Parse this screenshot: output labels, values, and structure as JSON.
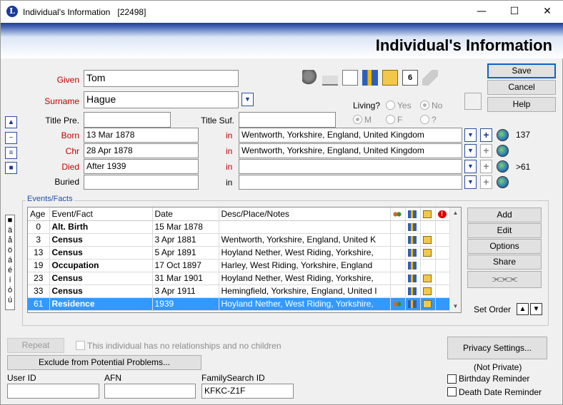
{
  "window": {
    "title": "Individual's Information",
    "id": "[22498]",
    "minimize": "—",
    "maximize": "☐",
    "close": "✕"
  },
  "banner": {
    "title": "Individual's Information"
  },
  "buttons": {
    "save": "Save",
    "cancel": "Cancel",
    "help": "Help",
    "add": "Add",
    "edit": "Edit",
    "options": "Options",
    "share": "Share",
    "repeat": "Repeat",
    "exclude": "Exclude from Potential Problems...",
    "privacy": "Privacy Settings..."
  },
  "fields": {
    "given_label": "Given",
    "given": "Tom",
    "surname_label": "Surname",
    "surname": "Hague",
    "title_pre_label": "Title Pre.",
    "title_pre": "",
    "title_suf_label": "Title Suf.",
    "title_suf": "",
    "living_label": "Living?",
    "yes": "Yes",
    "no": "No",
    "sex_m": "M",
    "sex_f": "F",
    "sex_q": "?"
  },
  "vitals": [
    {
      "label": "Born",
      "date": "13 Mar 1878",
      "in": "in",
      "place": "Wentworth, Yorkshire, England, United Kingdom",
      "count": "137"
    },
    {
      "label": "Chr",
      "date": "28 Apr 1878",
      "in": "in",
      "place": "Wentworth, Yorkshire, England, United Kingdom",
      "count": ""
    },
    {
      "label": "Died",
      "date": "After 1939",
      "in": "in",
      "place": "",
      "count": ">61"
    },
    {
      "label": "Buried",
      "date": "",
      "in": "in",
      "place": "",
      "count": ""
    }
  ],
  "events": {
    "group_label": "Events/Facts",
    "headers": [
      "Age",
      "Event/Fact",
      "Date",
      "Desc/Place/Notes"
    ],
    "rows": [
      {
        "age": "0",
        "event": "Alt. Birth",
        "date": "15 Mar 1878",
        "desc": "",
        "icons": [
          "",
          "book",
          ""
        ]
      },
      {
        "age": "3",
        "event": "Census",
        "date": "3 Apr 1881",
        "desc": "Wentworth, Yorkshire, England, United K",
        "icons": [
          "",
          "book",
          "pic"
        ]
      },
      {
        "age": "13",
        "event": "Census",
        "date": "5 Apr 1891",
        "desc": "Hoyland Nether, West Riding, Yorkshire,",
        "icons": [
          "",
          "book",
          "pic"
        ]
      },
      {
        "age": "19",
        "event": "Occupation",
        "date": "17 Oct 1897",
        "desc": "Harley, West Riding, Yorkshire, England",
        "icons": [
          "",
          "book",
          ""
        ]
      },
      {
        "age": "23",
        "event": "Census",
        "date": "31 Mar 1901",
        "desc": "Hoyland Nether, West Riding, Yorkshire,",
        "icons": [
          "",
          "book",
          "pic"
        ]
      },
      {
        "age": "33",
        "event": "Census",
        "date": "3 Apr 1911",
        "desc": "Hemingfield, Yorkshire, England, United I",
        "icons": [
          "",
          "book",
          "pic"
        ]
      },
      {
        "age": "61",
        "event": "Residence",
        "date": "1939",
        "desc": "Hoyland Nether, West Riding, Yorkshire,",
        "icons": [
          "ppl",
          "book",
          "pic"
        ]
      }
    ],
    "set_order": "Set Order"
  },
  "accent_chars": [
    "■",
    "ä",
    "å",
    "ö",
    "á",
    "é",
    "í",
    "ó",
    "ú"
  ],
  "footer": {
    "no_relationships": "This individual has no relationships and no children",
    "user_id_label": "User ID",
    "user_id": "",
    "afn_label": "AFN",
    "afn": "",
    "fs_label": "FamilySearch ID",
    "fs_id": "KFKC-Z1F",
    "not_private": "(Not Private)",
    "birthday_reminder": "Birthday Reminder",
    "death_reminder": "Death Date Reminder"
  },
  "colors": {
    "accent": "#c00000",
    "selection": "#3399ff",
    "banner": "#1f3f8f"
  }
}
